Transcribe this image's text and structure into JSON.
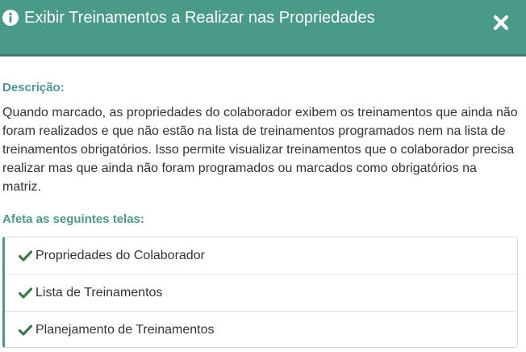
{
  "header": {
    "title": "Exibir Treinamentos a Realizar nas Propriedades",
    "info_icon": "info-circle-icon",
    "close_icon": "close-x-icon"
  },
  "description": {
    "label": "Descrição:",
    "text": "Quando marcado, as propriedades do colaborador exibem os treinamentos que ainda não foram realizados e que não estão na lista de treinamentos programados nem na lista de treinamentos obrigatórios. Isso permite visualizar treinamentos que o colaborador precisa realizar mas que ainda não foram programados ou marcados como obrigatórios na matriz."
  },
  "affects": {
    "label": "Afeta as seguintes telas:",
    "items": [
      {
        "label": "Propriedades do Colaborador",
        "icon": "check-icon"
      },
      {
        "label": "Lista de Treinamentos",
        "icon": "check-icon"
      },
      {
        "label": "Planejamento de Treinamentos",
        "icon": "check-icon"
      }
    ]
  },
  "colors": {
    "accent": "#4a9a89",
    "header_border": "#3d7d70",
    "check": "#3a7d44",
    "text": "#333333"
  }
}
